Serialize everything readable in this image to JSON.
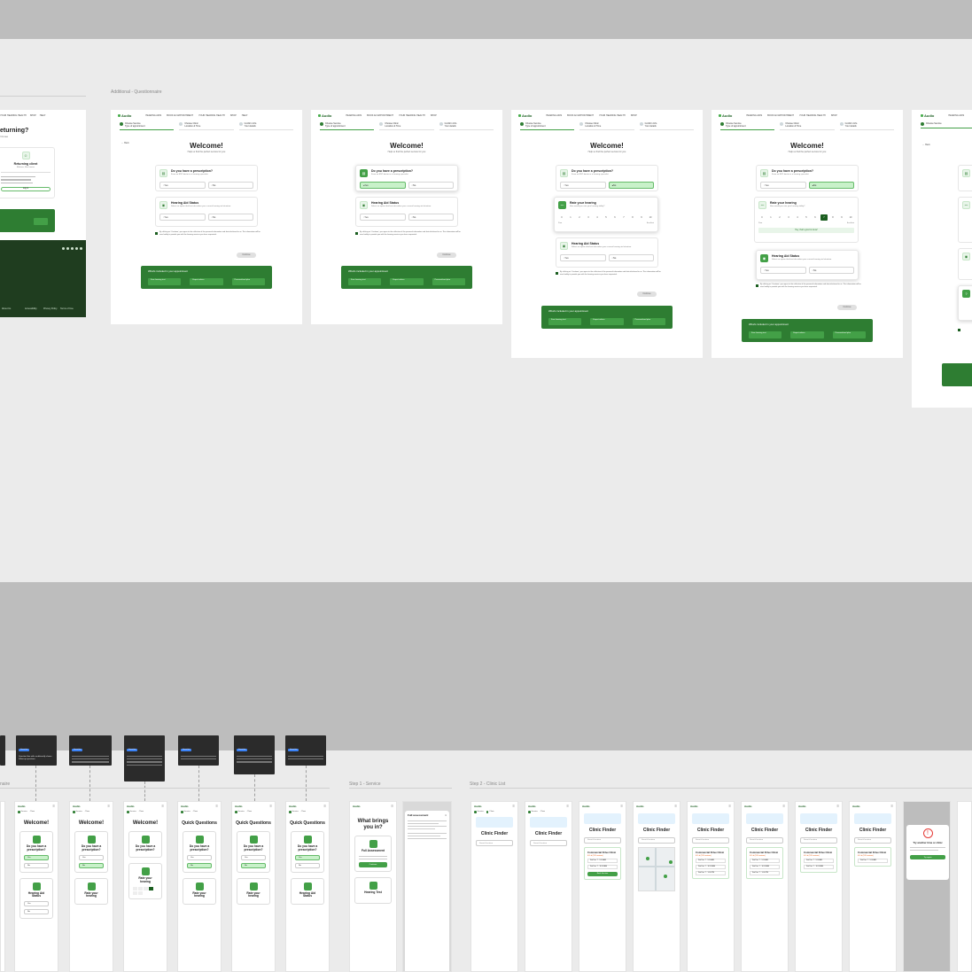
{
  "sections": {
    "questionnaire_label": "Additional - Questionnaire",
    "step1_label": "Step 1 - Service",
    "step2_label": "Step 2 - Clinic List",
    "left_mobile_label": "naire"
  },
  "left_partial": {
    "title": "eturning?",
    "sub": "rt to see",
    "card_title": "Returning client",
    "card_sub": "Mahnaz, Sfar Ineries",
    "login": "Log in",
    "footer_links": [
      "About Us",
      "Accessibility",
      "Privacy Policy",
      "Terms of Use",
      "Contact Us"
    ]
  },
  "nav": {
    "logo_line1": "Audio",
    "logo_line2": "Rx",
    "links": [
      "HEARING AIDS",
      "BOOK AN APPOINTMENT",
      "YOUR HEARING HEALTH",
      "SHOP",
      "HELP"
    ]
  },
  "steps": [
    {
      "title": "Choose Service",
      "sub": "Type of appointment"
    },
    {
      "title": "Choose Clinic",
      "sub": "Location & Time"
    },
    {
      "title": "Confirm Info",
      "sub": "Your details"
    }
  ],
  "welcome": {
    "back": "Back",
    "title": "Welcome!",
    "subtitle": "Help us find the perfect service for you"
  },
  "questions": {
    "prescription": {
      "title": "Do you have a prescription?",
      "desc": "From an ENT doctor or a hearing specialist"
    },
    "hearing_aid": {
      "title": "Hearing Aid Status",
      "desc": "Select an option that best describes your current hearing aid situation."
    },
    "rate": {
      "title": "Rate your hearing",
      "desc": "How would you rate your hearing ability?",
      "scale": [
        "0",
        "1",
        "2",
        "3",
        "4",
        "5",
        "6",
        "7",
        "8",
        "9",
        "10"
      ],
      "left": "Poor",
      "right": "Excellent",
      "feedback": "Hey, that's good to know!"
    },
    "yes": "Yes",
    "no": "No"
  },
  "consent": "By clicking on 'Continue', you agree to the collection of the personal information and data disclosed to us. This information will be used solely to provide you with the hearing services you have requested.",
  "continue": "Continue",
  "banner": {
    "title": "What's included in your appointment",
    "items": [
      "Free hearing test",
      "Expert advice",
      "Personalized plan"
    ]
  },
  "mobile": {
    "tabs": [
      "Service",
      "Clinic",
      "Confirm"
    ],
    "welcome": "Welcome!",
    "quick": "Quick Questions",
    "prescription": "Do you have a prescription?",
    "hearing_aid": "Hearing Aid Status",
    "rate": "Rate your hearing",
    "brings": "What brings you in?",
    "full_assessment": "Full Assessment",
    "hearing_test": "Hearing Test",
    "clinic_finder": "Clinic Finder",
    "search_placeholder": "Search location",
    "clinic_name": "Commercial Drive Clinic",
    "rating": "4.8 ★ (120 reviews)",
    "slots": [
      "Sat Dec 7 · 9:00 AM",
      "Sat Dec 7 · 10:30 AM",
      "Sat Dec 7 · 1:00 PM"
    ],
    "book": "Book this time",
    "full_assessment_sheet": "Full assessment",
    "error_title": "Try another time or clinic",
    "error_btn": "Try again",
    "note_tag": "Interaction",
    "note_text": "Question flow with conditionally shown follow-up questions"
  },
  "colors": {
    "brand_dark": "#1b5e20",
    "brand": "#2e7d32",
    "brand_light": "#43a047",
    "selected_fill": "#c8f1c9",
    "canvas": "#ebebeb",
    "band": "#bdbdbd"
  }
}
